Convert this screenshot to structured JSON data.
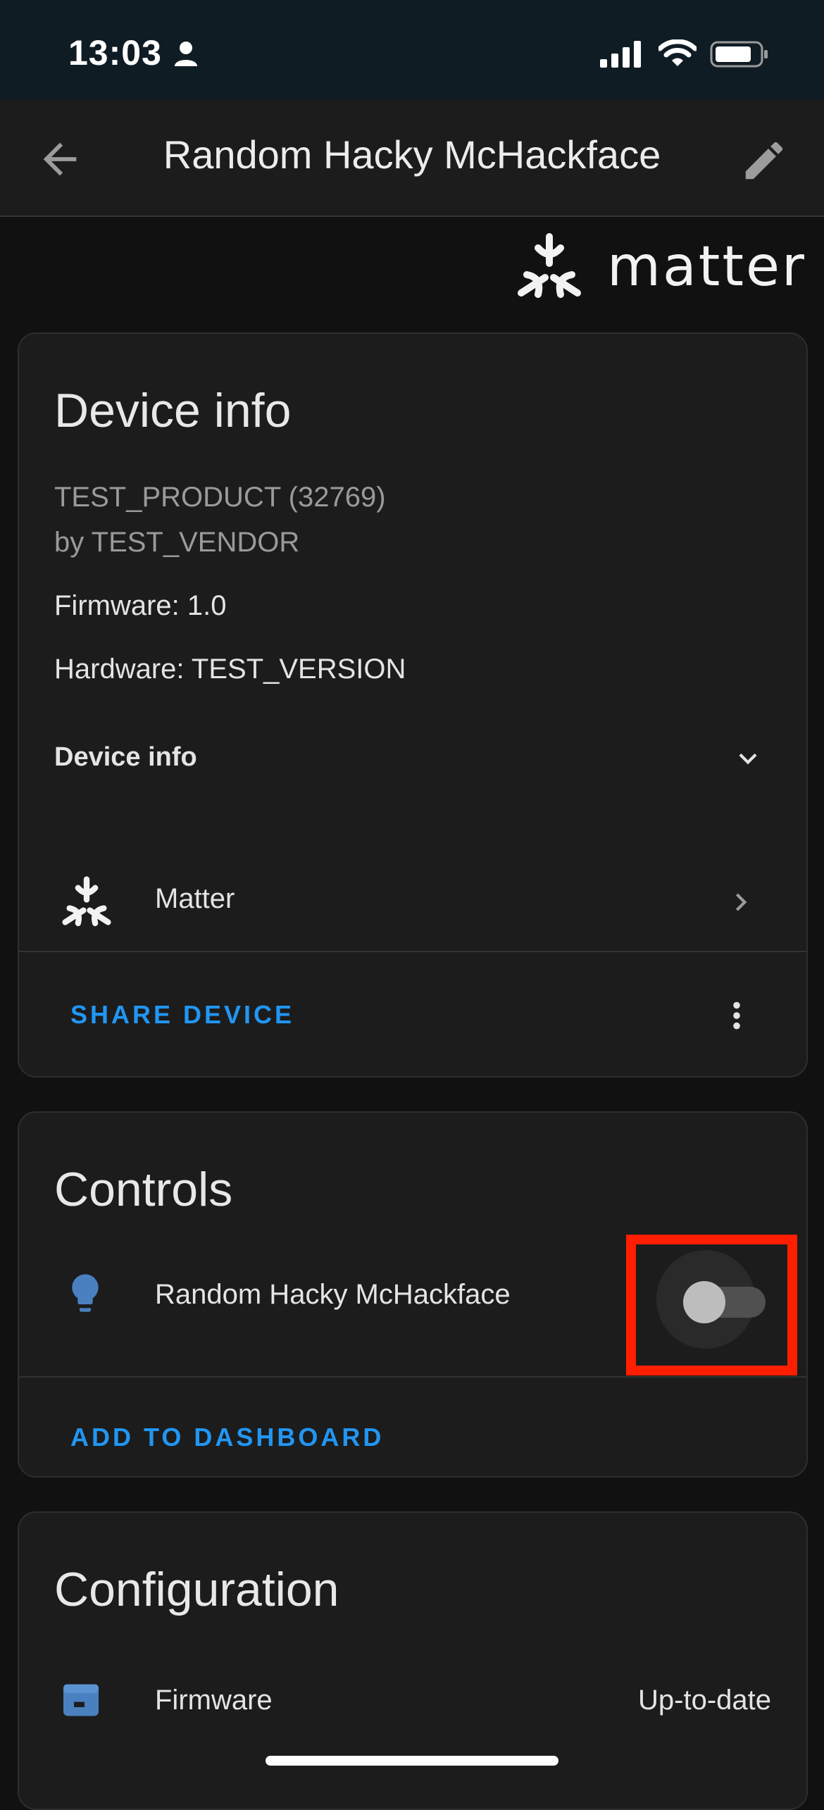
{
  "status_bar": {
    "time": "13:03",
    "icons": [
      "person-icon",
      "cellular-signal-icon",
      "wifi-icon",
      "battery-icon"
    ]
  },
  "header": {
    "title": "Random Hacky McHackface",
    "back_icon": "arrow-left-icon",
    "edit_icon": "pencil-icon"
  },
  "integration_logo": {
    "text": "matter",
    "icon": "matter-logo-icon"
  },
  "device_info_card": {
    "title": "Device info",
    "product": "TEST_PRODUCT (32769)",
    "vendor": "by TEST_VENDOR",
    "firmware": "Firmware: 1.0",
    "hardware": "Hardware: TEST_VERSION",
    "expander_label": "Device info",
    "integration_row_label": "Matter",
    "share_action": "SHARE DEVICE"
  },
  "controls_card": {
    "title": "Controls",
    "entity_label": "Random Hacky McHackface",
    "entity_icon": "lightbulb-icon",
    "toggle_state": "off",
    "add_action": "ADD TO DASHBOARD"
  },
  "configuration_card": {
    "title": "Configuration",
    "row_label": "Firmware",
    "row_value": "Up-to-date",
    "row_icon": "package-icon"
  },
  "colors": {
    "accent": "#2196f3",
    "background": "#111111",
    "card": "#1c1c1c",
    "highlight": "#ff1f00",
    "entity_icon": "#4a80c0"
  }
}
